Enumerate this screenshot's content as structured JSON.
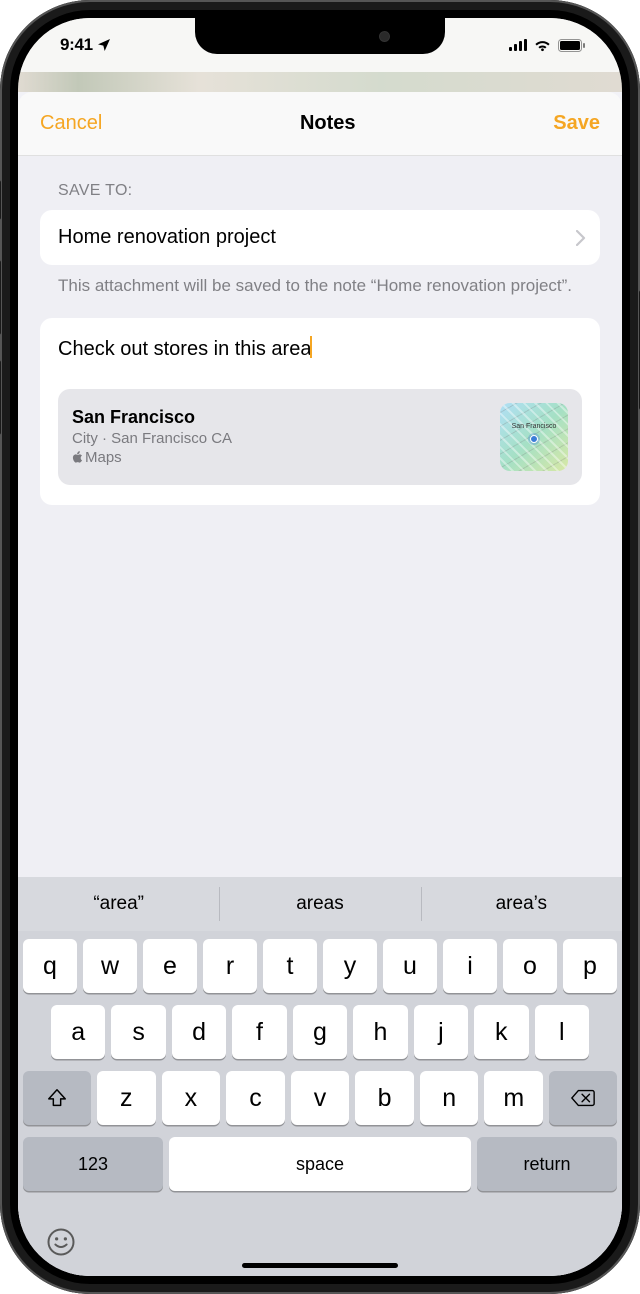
{
  "status_bar": {
    "time": "9:41"
  },
  "sheet": {
    "cancel": "Cancel",
    "title": "Notes",
    "save": "Save",
    "section_label": "SAVE TO:",
    "destination_note": "Home renovation project",
    "helper_text": "This attachment will be saved to the note “Home renovation project”.",
    "note_text": "Check out stores in this area",
    "attachment": {
      "title": "San Francisco",
      "subtitle": "City · San Francisco CA",
      "source": "Maps",
      "thumb_label": "San Francisco"
    }
  },
  "keyboard": {
    "predictions": [
      "“area”",
      "areas",
      "area’s"
    ],
    "row1": [
      "q",
      "w",
      "e",
      "r",
      "t",
      "y",
      "u",
      "i",
      "o",
      "p"
    ],
    "row2": [
      "a",
      "s",
      "d",
      "f",
      "g",
      "h",
      "j",
      "k",
      "l"
    ],
    "row3": [
      "z",
      "x",
      "c",
      "v",
      "b",
      "n",
      "m"
    ],
    "numkey": "123",
    "space": "space",
    "return": "return"
  }
}
